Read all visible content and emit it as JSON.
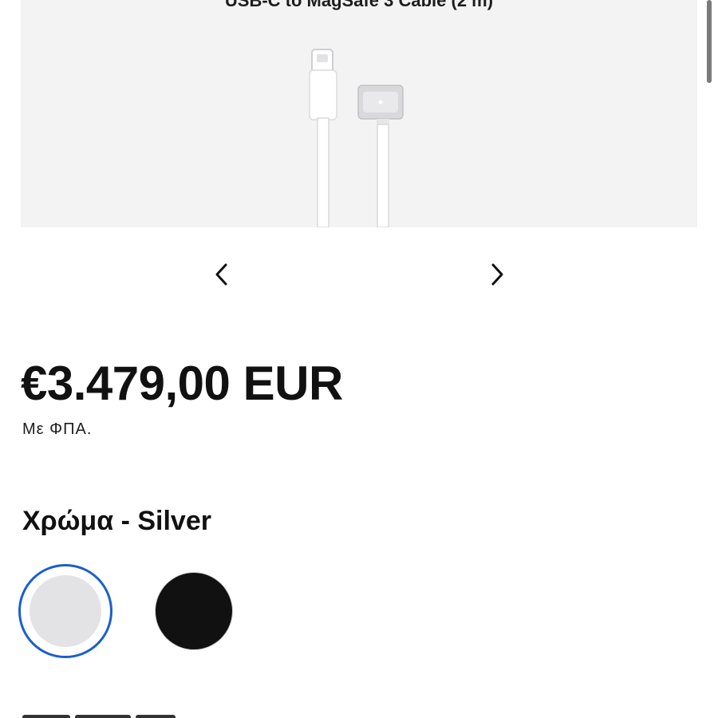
{
  "gallery": {
    "caption": "USB-C to MagSafe 3 Cable (2 m)",
    "image_icon": "usb-c-to-magsafe-cable-image",
    "prev_icon": "chevron-left-icon",
    "next_icon": "chevron-right-icon"
  },
  "product": {
    "price": "€3.479,00 EUR",
    "vat_note": "Με ΦΠΑ."
  },
  "color": {
    "title": "Χρώμα - Silver",
    "options": [
      {
        "name": "Silver",
        "hex": "#e3e3e6",
        "selected": true
      },
      {
        "name": "Black",
        "hex": "#111111",
        "selected": false
      }
    ],
    "selected_ring": "#1a5fd0"
  },
  "theme": {
    "gallery_bg": "#f3f3f4",
    "text": "#111111"
  }
}
